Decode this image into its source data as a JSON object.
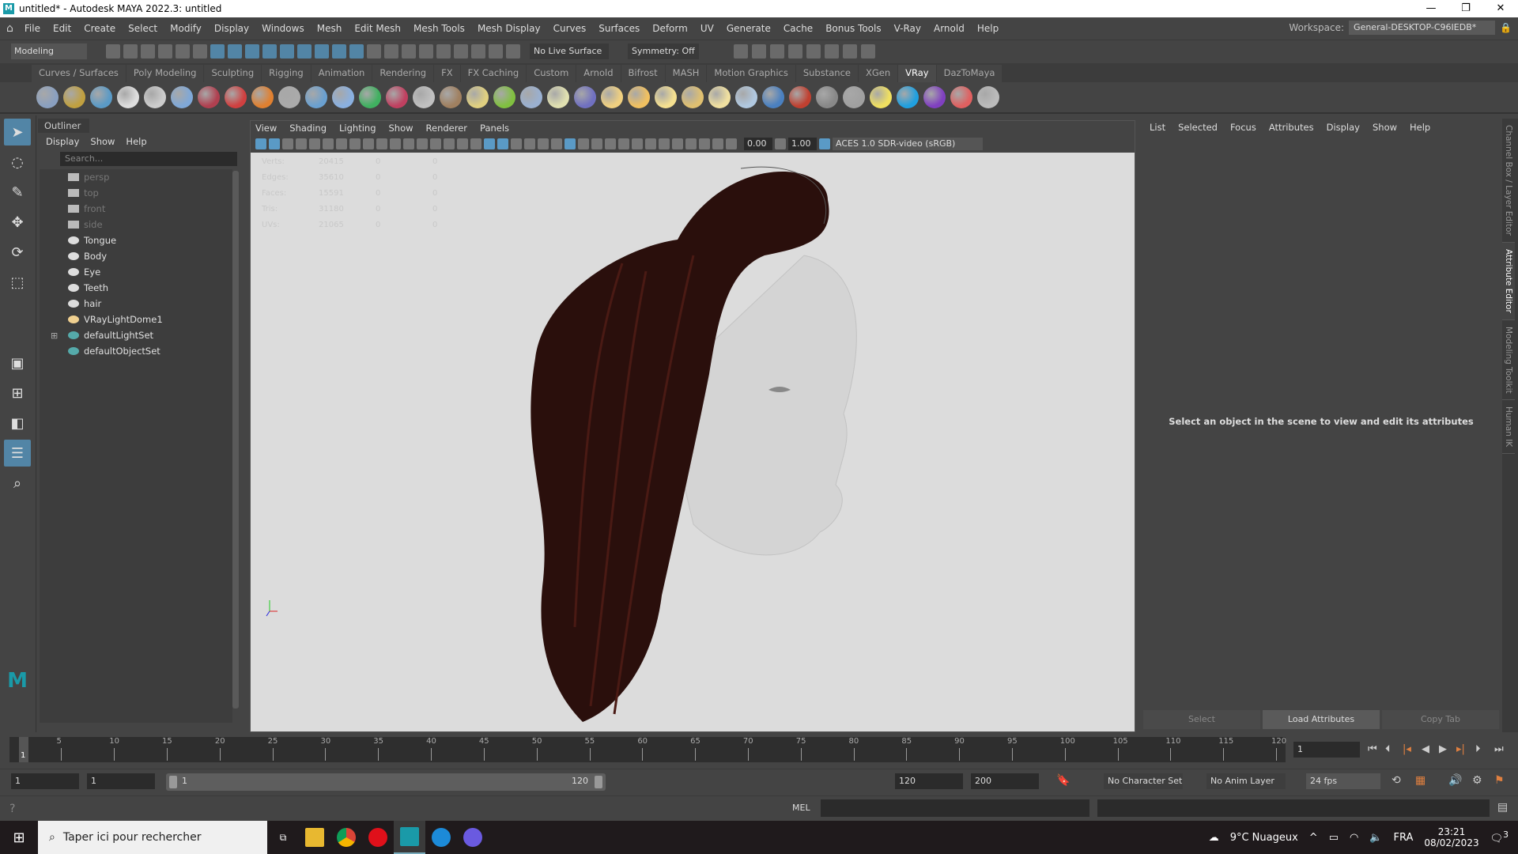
{
  "window": {
    "title": "untitled* - Autodesk MAYA 2022.3: untitled",
    "logo": "M",
    "minimize": "—",
    "maximize": "❐",
    "close": "✕"
  },
  "menubar": {
    "items": [
      "File",
      "Edit",
      "Create",
      "Select",
      "Modify",
      "Display",
      "Windows",
      "Mesh",
      "Edit Mesh",
      "Mesh Tools",
      "Mesh Display",
      "Curves",
      "Surfaces",
      "Deform",
      "UV",
      "Generate",
      "Cache",
      "Bonus Tools",
      "V-Ray",
      "Arnold",
      "Help"
    ],
    "workspace_label": "Workspace:",
    "workspace_value": "General-DESKTOP-C96IEDB*"
  },
  "statusline": {
    "mode": "Modeling",
    "live_surface": "No Live Surface",
    "symmetry": "Symmetry: Off"
  },
  "shelf": {
    "tabs": [
      "Curves / Surfaces",
      "Poly Modeling",
      "Sculpting",
      "Rigging",
      "Animation",
      "Rendering",
      "FX",
      "FX Caching",
      "Custom",
      "Arnold",
      "Bifrost",
      "MASH",
      "Motion Graphics",
      "Substance",
      "XGen",
      "VRay",
      "DazToMaya"
    ],
    "active_tab": "VRay",
    "icon_colors": [
      "#8aa0c0",
      "#c0a040",
      "#5a9ac6",
      "#dddddd",
      "#cccccc",
      "#7fa8d8",
      "#b04050",
      "#d04040",
      "#e08030",
      "#aaaaaa",
      "#6aa0d0",
      "#8ab0e0",
      "#40b060",
      "#c04060",
      "#c0c0c0",
      "#a08060",
      "#e0d080",
      "#80c040",
      "#9ab0d0",
      "#e0e0b0",
      "#7070c0",
      "#f0d080",
      "#f0c060",
      "#f5e090",
      "#e0c070",
      "#f0e0a0",
      "#b0c8e0",
      "#4a80c0",
      "#c04030",
      "#888888",
      "#a0a0a0",
      "#f0e060",
      "#20a0e0",
      "#8040c0",
      "#e06060",
      "#bbbbbb"
    ]
  },
  "outliner": {
    "title": "Outliner",
    "menu": [
      "Display",
      "Show",
      "Help"
    ],
    "search_placeholder": "Search...",
    "items": [
      {
        "label": "persp",
        "type": "camera",
        "dim": true
      },
      {
        "label": "top",
        "type": "camera",
        "dim": true
      },
      {
        "label": "front",
        "type": "camera",
        "dim": true
      },
      {
        "label": "side",
        "type": "camera",
        "dim": true
      },
      {
        "label": "Tongue",
        "type": "mesh"
      },
      {
        "label": "Body",
        "type": "mesh"
      },
      {
        "label": "Eye",
        "type": "mesh"
      },
      {
        "label": "Teeth",
        "type": "mesh"
      },
      {
        "label": "hair",
        "type": "mesh"
      },
      {
        "label": "VRayLightDome1",
        "type": "light"
      },
      {
        "label": "defaultLightSet",
        "type": "set",
        "expand": "⊞"
      },
      {
        "label": "defaultObjectSet",
        "type": "set"
      }
    ]
  },
  "viewport": {
    "menu": [
      "View",
      "Shading",
      "Lighting",
      "Show",
      "Renderer",
      "Panels"
    ],
    "exposure": "0.00",
    "gamma": "1.00",
    "color_space": "ACES 1.0 SDR-video (sRGB)",
    "hud": [
      {
        "label": "Verts:",
        "v": "20415",
        "s": "0",
        "t": "0"
      },
      {
        "label": "Edges:",
        "v": "35610",
        "s": "0",
        "t": "0"
      },
      {
        "label": "Faces:",
        "v": "15591",
        "s": "0",
        "t": "0"
      },
      {
        "label": "Tris:",
        "v": "31180",
        "s": "0",
        "t": "0"
      },
      {
        "label": "UVs:",
        "v": "21065",
        "s": "0",
        "t": "0"
      }
    ]
  },
  "attribute_editor": {
    "menu": [
      "List",
      "Selected",
      "Focus",
      "Attributes",
      "Display",
      "Show",
      "Help"
    ],
    "message": "Select an object in the scene to view and edit its attributes",
    "buttons": [
      "Select",
      "Load Attributes",
      "Copy Tab"
    ]
  },
  "side_tabs": [
    "Channel Box / Layer Editor",
    "Attribute Editor",
    "Modeling Toolkit",
    "Human IK"
  ],
  "timeline": {
    "tick_labels": [
      "5",
      "10",
      "15",
      "20",
      "25",
      "30",
      "35",
      "40",
      "45",
      "50",
      "55",
      "60",
      "65",
      "70",
      "75",
      "80",
      "85",
      "90",
      "95",
      "100",
      "105",
      "110",
      "115",
      "120"
    ],
    "start": 1,
    "end": 120,
    "current_frame": "1",
    "current_field": "1"
  },
  "range": {
    "start_field": "1",
    "playback_start": "1",
    "range_start": "1",
    "range_end": "120",
    "playback_end": "120",
    "end_field": "200",
    "character_set": "No Character Set",
    "anim_layer": "No Anim Layer",
    "fps": "24 fps"
  },
  "command": {
    "language": "MEL"
  },
  "taskbar": {
    "search": "Taper ici pour rechercher",
    "weather": "9°C  Nuageux",
    "lang": "FRA",
    "time": "23:21",
    "date": "08/02/2023",
    "notifications": "3"
  }
}
